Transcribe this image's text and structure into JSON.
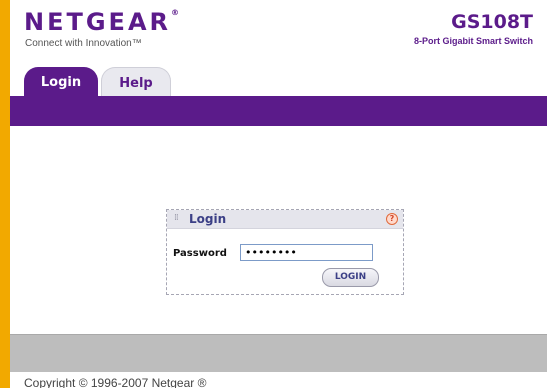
{
  "brand": {
    "logo": "NETGEAR",
    "logo_mark": "®",
    "tagline": "Connect with Innovation™",
    "model": "GS108T",
    "model_desc": "8-Port Gigabit Smart Switch"
  },
  "tabs": [
    {
      "label": "Login",
      "active": true
    },
    {
      "label": "Help",
      "active": false
    }
  ],
  "login_panel": {
    "title": "Login",
    "help_icon_glyph": "?",
    "password_label": "Password",
    "password_value": "••••••••",
    "login_button": "LOGIN"
  },
  "footer": {
    "copyright": "Copyright © 1996-2007 Netgear ®"
  },
  "colors": {
    "brand_purple": "#5b1b8a",
    "frame_orange": "#f2a900",
    "footer_gray": "#bdbdbd"
  }
}
